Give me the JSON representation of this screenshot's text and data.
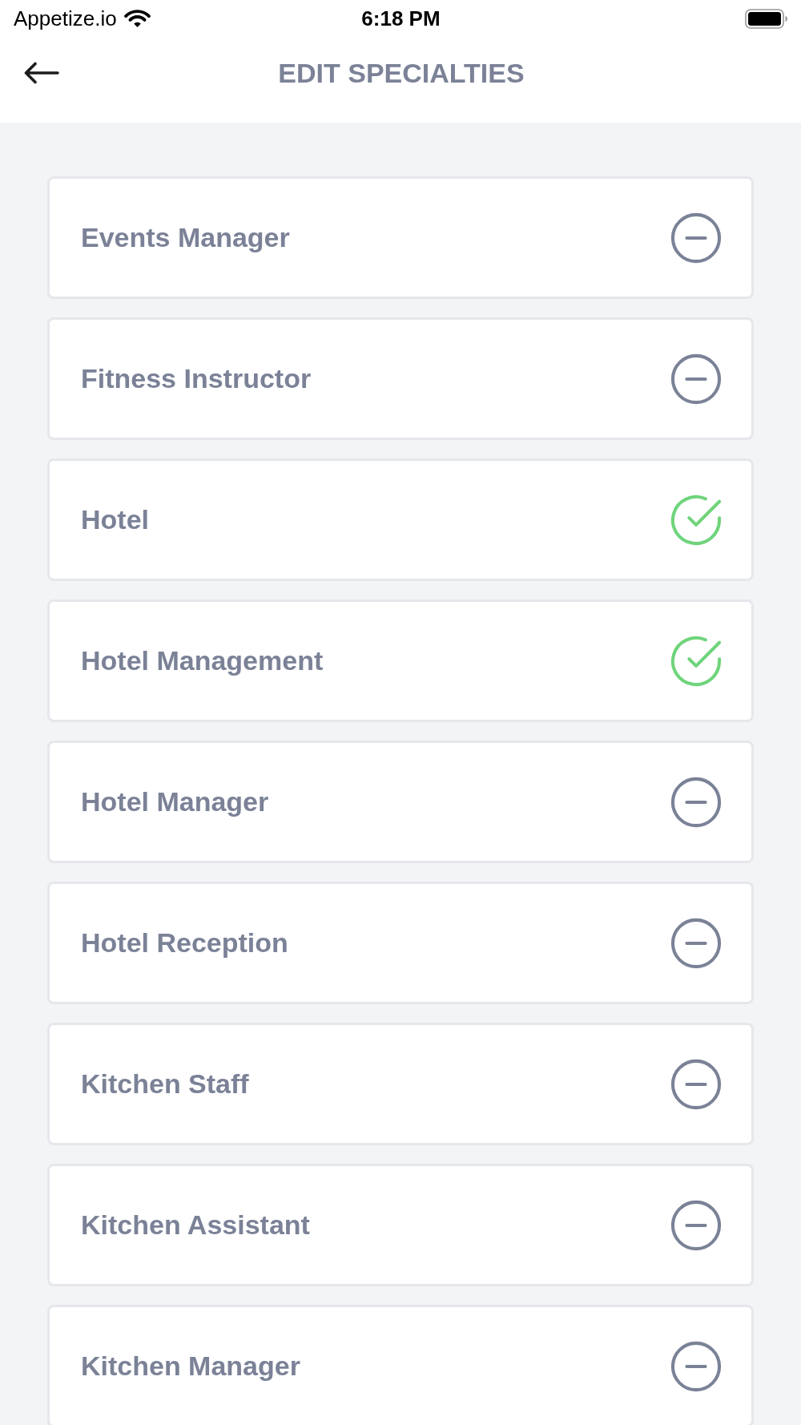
{
  "status_bar": {
    "carrier": "Appetize.io",
    "time": "6:18 PM"
  },
  "header": {
    "title": "EDIT SPECIALTIES"
  },
  "specialties": [
    {
      "name": "Events Manager",
      "selected": false
    },
    {
      "name": "Fitness Instructor",
      "selected": false
    },
    {
      "name": "Hotel",
      "selected": true
    },
    {
      "name": "Hotel Management",
      "selected": true
    },
    {
      "name": "Hotel Manager",
      "selected": false
    },
    {
      "name": "Hotel Reception",
      "selected": false
    },
    {
      "name": "Kitchen Staff",
      "selected": false
    },
    {
      "name": "Kitchen Assistant",
      "selected": false
    },
    {
      "name": "Kitchen Manager",
      "selected": false
    }
  ]
}
